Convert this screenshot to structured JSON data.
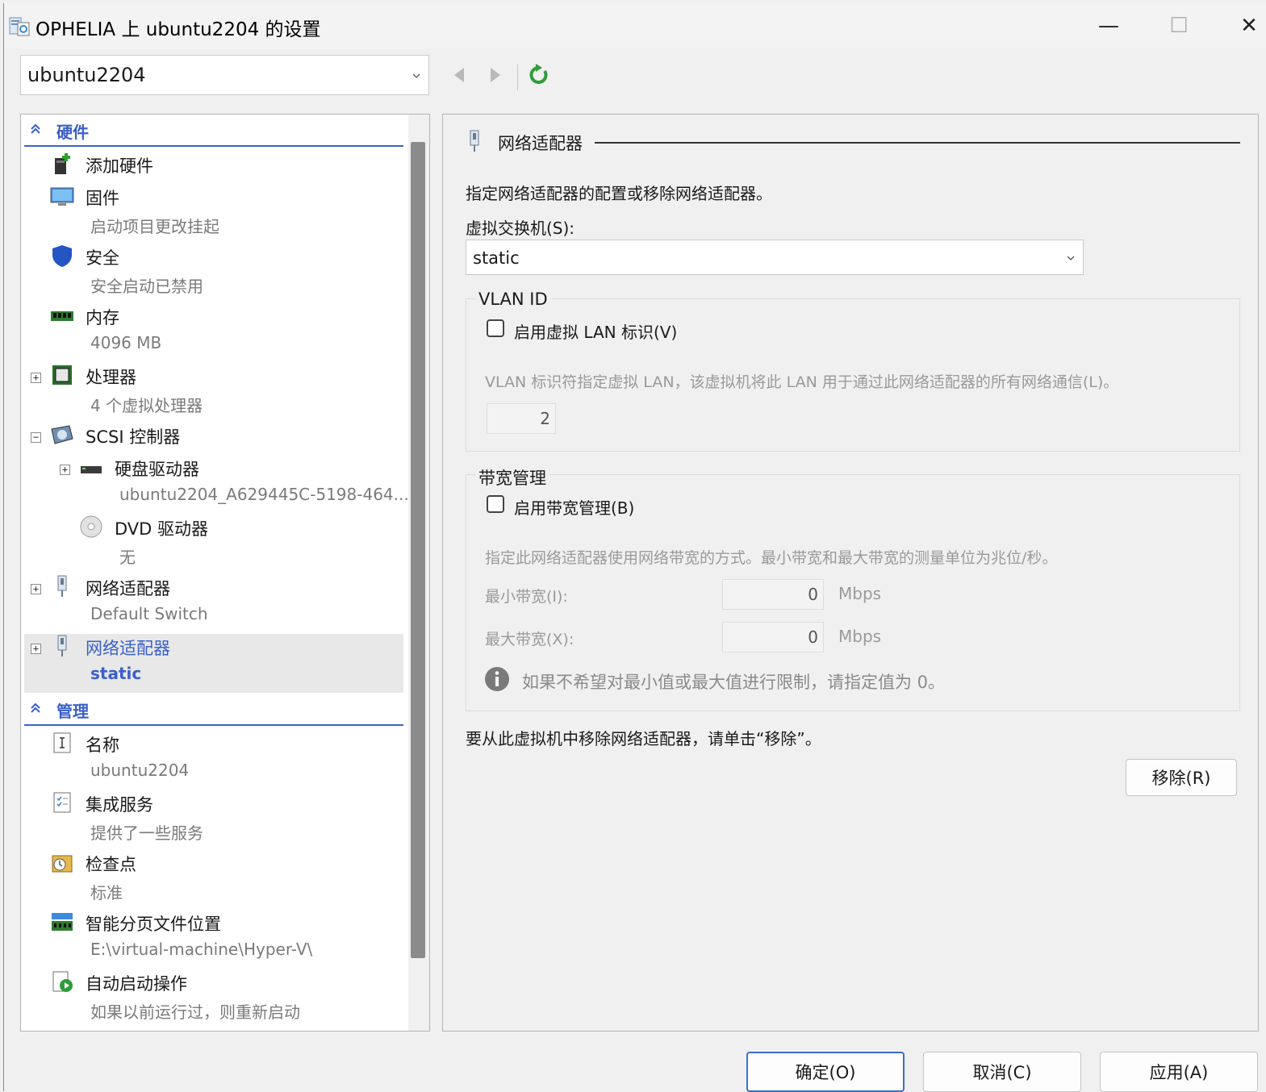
{
  "window": {
    "title": "OPHELIA 上 ubuntu2204 的设置",
    "minimize": "—",
    "maximize": "☐",
    "close": "✕"
  },
  "vm_select": {
    "value": "ubuntu2204"
  },
  "tree": {
    "hardware_header": "硬件",
    "items": [
      {
        "label": "添加硬件"
      },
      {
        "label": "固件",
        "sub": "启动项目更改挂起"
      },
      {
        "label": "安全",
        "sub": "安全启动已禁用"
      },
      {
        "label": "内存",
        "sub": "4096 MB"
      },
      {
        "label": "处理器",
        "sub": "4 个虚拟处理器"
      },
      {
        "label": "SCSI 控制器"
      },
      {
        "label": "硬盘驱动器",
        "sub": "ubuntu2204_A629445C-5198-464..."
      },
      {
        "label": "DVD 驱动器",
        "sub": "无"
      },
      {
        "label": "网络适配器",
        "sub": "Default Switch"
      },
      {
        "label": "网络适配器",
        "sub": "static"
      }
    ],
    "management_header": "管理",
    "mgmt_items": [
      {
        "label": "名称",
        "sub": "ubuntu2204"
      },
      {
        "label": "集成服务",
        "sub": "提供了一些服务"
      },
      {
        "label": "检查点",
        "sub": "标准"
      },
      {
        "label": "智能分页文件位置",
        "sub": "E:\\virtual-machine\\Hyper-V\\"
      },
      {
        "label": "自动启动操作",
        "sub": "如果以前运行过，则重新启动"
      }
    ]
  },
  "panel": {
    "title": "网络适配器",
    "description": "指定网络适配器的配置或移除网络适配器。",
    "switch_label": "虚拟交换机(S):",
    "switch_value": "static",
    "vlan": {
      "group_title": "VLAN ID",
      "checkbox_label": "启用虚拟 LAN 标识(V)",
      "hint": "VLAN 标识符指定虚拟 LAN，该虚拟机将此 LAN 用于通过此网络适配器的所有网络通信(L)。",
      "value": "2"
    },
    "bandwidth": {
      "group_title": "带宽管理",
      "checkbox_label": "启用带宽管理(B)",
      "hint": "指定此网络适配器使用网络带宽的方式。最小带宽和最大带宽的测量单位为兆位/秒。",
      "min_label": "最小带宽(I):",
      "min_value": "0",
      "max_label": "最大带宽(X):",
      "max_value": "0",
      "unit": "Mbps",
      "info": "如果不希望对最小值或最大值进行限制，请指定值为 0。"
    },
    "remove_hint": "要从此虚拟机中移除网络适配器，请单击“移除”。",
    "remove_button": "移除(R)"
  },
  "footer": {
    "ok": "确定(O)",
    "cancel": "取消(C)",
    "apply": "应用(A)"
  },
  "colors": {
    "accent": "#3b63c4",
    "refresh": "#2e9d3a"
  }
}
